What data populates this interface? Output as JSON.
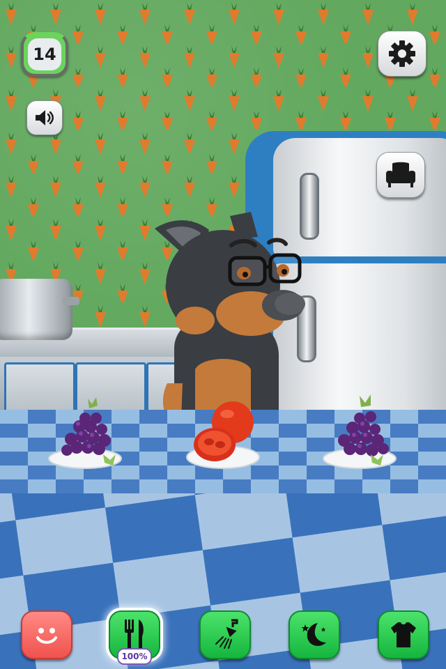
{
  "hud": {
    "level": "14",
    "level_progress": 0.25,
    "sound_icon": "speaker-icon",
    "settings_icon": "gear-icon",
    "room_icon": "armchair-icon"
  },
  "scene": {
    "room": "kitchen",
    "food_items": [
      "grapes",
      "tomato",
      "grapes"
    ]
  },
  "bottom_bar": {
    "items": [
      {
        "name": "happiness",
        "icon": "smiley-icon",
        "color": "#f0524d"
      },
      {
        "name": "food",
        "icon": "fork-knife-icon",
        "color": "#15b63e",
        "active": true
      },
      {
        "name": "wash",
        "icon": "shower-icon",
        "color": "#15b63e"
      },
      {
        "name": "sleep",
        "icon": "moon-icon",
        "color": "#15b63e"
      },
      {
        "name": "wardrobe",
        "icon": "shirt-icon",
        "color": "#15b63e"
      }
    ],
    "food_percent": "100%"
  }
}
